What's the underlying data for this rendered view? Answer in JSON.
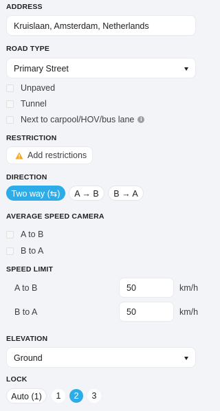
{
  "address": {
    "title": "ADDRESS",
    "value": "Kruislaan, Amsterdam, Netherlands"
  },
  "road_type": {
    "title": "ROAD TYPE",
    "selected": "Primary Street",
    "options": [
      {
        "label": "Unpaved",
        "checked": false
      },
      {
        "label": "Tunnel",
        "checked": false
      },
      {
        "label": "Next to carpool/HOV/bus lane",
        "checked": false
      }
    ]
  },
  "restriction": {
    "title": "RESTRICTION",
    "button_label": "Add restrictions",
    "icon": "warning-icon"
  },
  "direction": {
    "title": "DIRECTION",
    "options": [
      {
        "label": "Two way (⇆)",
        "active": true
      },
      {
        "label": "A → B",
        "active": false
      },
      {
        "label": "B → A",
        "active": false
      }
    ]
  },
  "speed_camera": {
    "title": "AVERAGE SPEED CAMERA",
    "options": [
      {
        "label": "A to B",
        "checked": false
      },
      {
        "label": "B to A",
        "checked": false
      }
    ]
  },
  "speed_limit": {
    "title": "SPEED LIMIT",
    "rows": [
      {
        "label": "A to B",
        "value": "50",
        "unit": "km/h"
      },
      {
        "label": "B to A",
        "value": "50",
        "unit": "km/h"
      }
    ]
  },
  "elevation": {
    "title": "ELEVATION",
    "selected": "Ground"
  },
  "lock": {
    "title": "LOCK",
    "auto_label": "Auto (1)",
    "levels": [
      "1",
      "2",
      "3"
    ],
    "active_level": "2"
  },
  "colors": {
    "accent": "#2dace7",
    "background": "#f2f4f7",
    "warning": "#f5a623"
  }
}
